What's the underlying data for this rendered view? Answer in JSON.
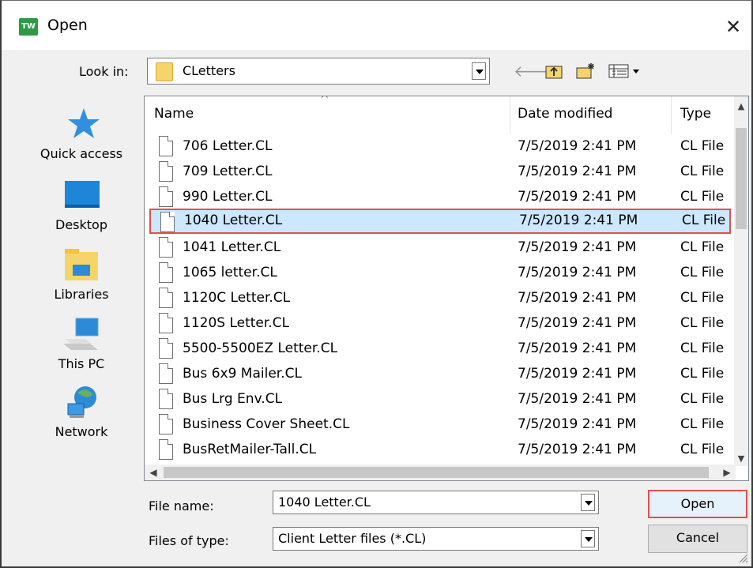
{
  "window": {
    "title": "Open",
    "app_icon_text": "TW"
  },
  "toolbar": {
    "look_in_label": "Look in:",
    "look_in_value": "CLetters",
    "tools": [
      "back-icon",
      "up-folder-icon",
      "new-folder-icon",
      "view-menu-icon"
    ]
  },
  "places": [
    {
      "label": "Quick access",
      "icon": "quick-access-star-icon"
    },
    {
      "label": "Desktop",
      "icon": "desktop-icon"
    },
    {
      "label": "Libraries",
      "icon": "libraries-icon"
    },
    {
      "label": "This PC",
      "icon": "this-pc-icon"
    },
    {
      "label": "Network",
      "icon": "network-icon"
    }
  ],
  "list": {
    "columns": [
      "Name",
      "Date modified",
      "Type"
    ],
    "files": [
      {
        "name": "706 Letter.CL",
        "date": "7/5/2019 2:41 PM",
        "type": "CL File"
      },
      {
        "name": "709 Letter.CL",
        "date": "7/5/2019 2:41 PM",
        "type": "CL File"
      },
      {
        "name": "990 Letter.CL",
        "date": "7/5/2019 2:41 PM",
        "type": "CL File"
      },
      {
        "name": "1040 Letter.CL",
        "date": "7/5/2019 2:41 PM",
        "type": "CL File",
        "selected": true
      },
      {
        "name": "1041 Letter.CL",
        "date": "7/5/2019 2:41 PM",
        "type": "CL File"
      },
      {
        "name": "1065 letter.CL",
        "date": "7/5/2019 2:41 PM",
        "type": "CL File"
      },
      {
        "name": "1120C Letter.CL",
        "date": "7/5/2019 2:41 PM",
        "type": "CL File"
      },
      {
        "name": "1120S Letter.CL",
        "date": "7/5/2019 2:41 PM",
        "type": "CL File"
      },
      {
        "name": "5500-5500EZ Letter.CL",
        "date": "7/5/2019 2:41 PM",
        "type": "CL File"
      },
      {
        "name": "Bus 6x9 Mailer.CL",
        "date": "7/5/2019 2:41 PM",
        "type": "CL File"
      },
      {
        "name": "Bus Lrg Env.CL",
        "date": "7/5/2019 2:41 PM",
        "type": "CL File"
      },
      {
        "name": "Business Cover Sheet.CL",
        "date": "7/5/2019 2:41 PM",
        "type": "CL File"
      },
      {
        "name": "BusRetMailer-Tall.CL",
        "date": "7/5/2019 2:41 PM",
        "type": "CL File"
      }
    ]
  },
  "footer": {
    "file_name_label": "File name:",
    "file_name_value": "1040 Letter.CL",
    "file_type_label": "Files of type:",
    "file_type_value": "Client Letter files (*.CL)",
    "open_label": "Open",
    "cancel_label": "Cancel"
  },
  "colors": {
    "selection_bg": "#cce8ff",
    "highlight_border": "#e05050"
  }
}
